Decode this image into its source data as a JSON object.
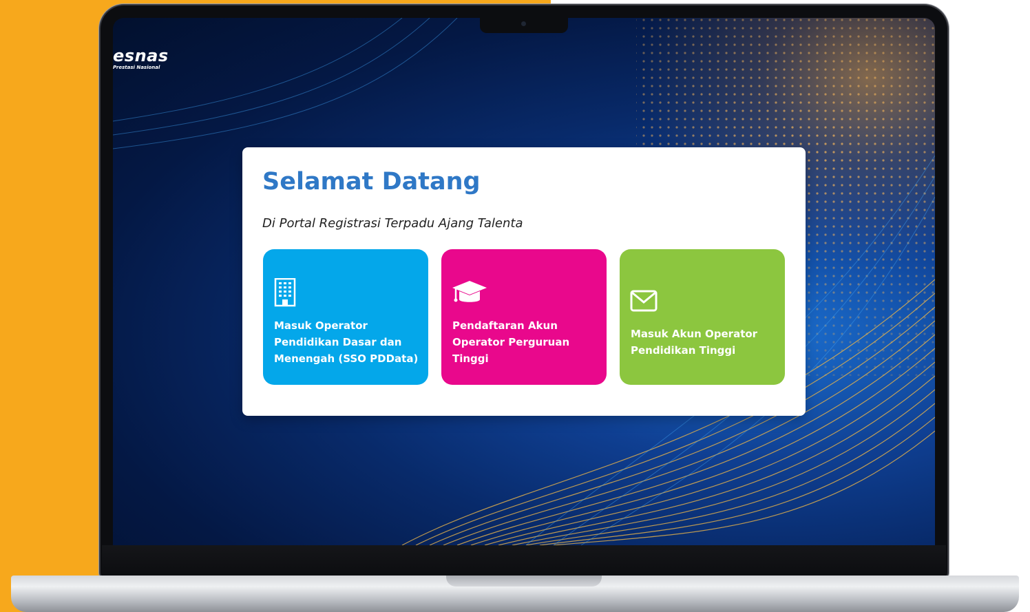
{
  "logo": {
    "text": "esnas",
    "subtitle": "Prestasi Nasional"
  },
  "welcome": {
    "title": "Selamat Datang",
    "subtitle": "Di Portal Registrasi Terpadu Ajang Talenta"
  },
  "options": [
    {
      "label": "Masuk Operator\nPendidikan Dasar dan\nMenengah (SSO PDData)",
      "icon": "building-icon",
      "color": "#04a7ea"
    },
    {
      "label": "Pendaftaran Akun\nOperator Perguruan\nTinggi",
      "icon": "graduation-cap-icon",
      "color": "#e9088c"
    },
    {
      "label": "Masuk Akun Operator\nPendidikan Tinggi",
      "icon": "envelope-icon",
      "color": "#8cc63f"
    }
  ],
  "colors": {
    "background_accent": "#f7a81c",
    "title": "#2f78c6"
  }
}
